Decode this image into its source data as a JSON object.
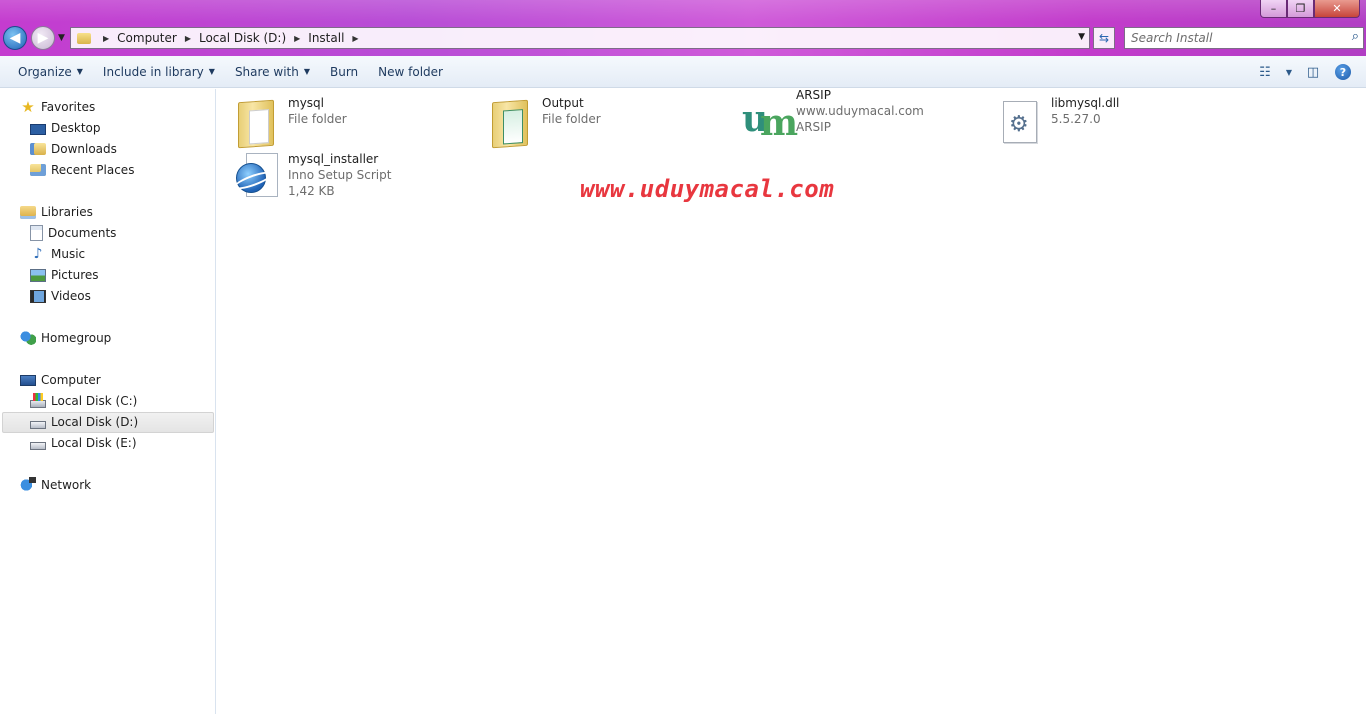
{
  "address": {
    "breadcrumbs": [
      "Computer",
      "Local Disk (D:)",
      "Install"
    ]
  },
  "search": {
    "placeholder": "Search Install"
  },
  "window_controls": {
    "minimize": "–",
    "maximize": "❐",
    "close": "✕"
  },
  "toolbar": {
    "organize": "Organize",
    "include_in_library": "Include in library",
    "share_with": "Share with",
    "burn": "Burn",
    "new_folder": "New folder",
    "help": "?"
  },
  "sidebar": {
    "favorites": {
      "label": "Favorites",
      "items": [
        "Desktop",
        "Downloads",
        "Recent Places"
      ]
    },
    "libraries": {
      "label": "Libraries",
      "items": [
        "Documents",
        "Music",
        "Pictures",
        "Videos"
      ]
    },
    "homegroup": "Homegroup",
    "computer": {
      "label": "Computer",
      "items": [
        "Local Disk (C:)",
        "Local Disk (D:)",
        "Local Disk (E:)"
      ],
      "selected": "Local Disk (D:)"
    },
    "network": "Network"
  },
  "files": [
    {
      "name": "mysql",
      "line1": "File folder",
      "line2": "",
      "icon": "folder-icon"
    },
    {
      "name": "Output",
      "line1": "File folder",
      "line2": "",
      "icon": "folder-icon"
    },
    {
      "name": "ARSIP",
      "line1": "www.uduymacal.com",
      "line2": "ARSIP",
      "icon": "um-logo-icon"
    },
    {
      "name": "libmysql.dll",
      "line1": "5.5.27.0",
      "line2": "",
      "icon": "dll-gear-icon"
    },
    {
      "name": "mysql_installer",
      "line1": "Inno Setup Script",
      "line2": "1,42 KB",
      "icon": "inno-setup-icon"
    }
  ],
  "watermark": "www.uduymacal.com",
  "colors": {
    "titlebar": "#c43ccf",
    "watermark": "#e8373f",
    "selection": "#e4e4e4"
  }
}
